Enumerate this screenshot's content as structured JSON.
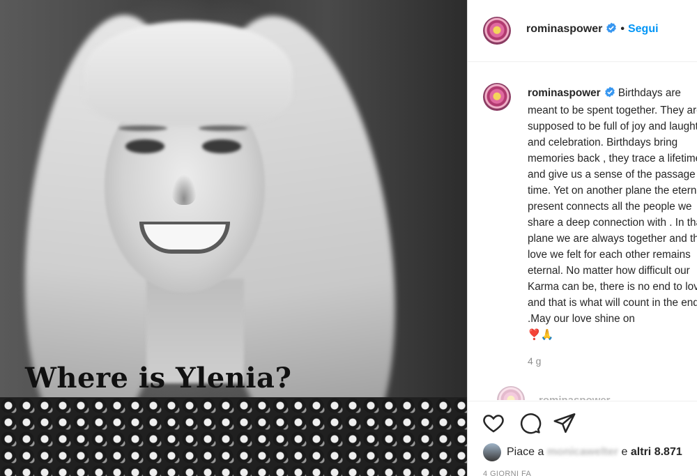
{
  "post": {
    "image": {
      "overlay_text": "Where is Ylenia?"
    },
    "header": {
      "username": "rominaspower",
      "separator": "•",
      "follow_label": "Segui"
    },
    "caption": {
      "username": "rominaspower",
      "text": "Birthdays are meant to be spent together. They are supposed to be full of joy and laughter and celebration. Birthdays bring memories back , they trace a lifetime and give us a sense of the passage of time. Yet on another plane the eternal present connects all the people we share a deep connection with . In that plane we are always together and the love we felt for each other remains eternal. No matter how difficult our Karma can be, there is no end to love and that is what will count in the end .May our love shine on",
      "emoji": "❣️🙏",
      "time_ago": "4 g"
    },
    "next_comment": {
      "username": "rominaspower"
    },
    "actions": {
      "like_icon": "heart-icon",
      "comment_icon": "comment-icon",
      "share_icon": "paper-plane-icon"
    },
    "likes": {
      "prefix": "Piace a",
      "liker": "monicawelter",
      "middle": "e",
      "others": "altri 8.871"
    },
    "date": "4 GIORNI FA"
  },
  "colors": {
    "link_blue": "#0095f6",
    "verified_blue": "#3897f0",
    "muted": "#8e8e8e"
  }
}
